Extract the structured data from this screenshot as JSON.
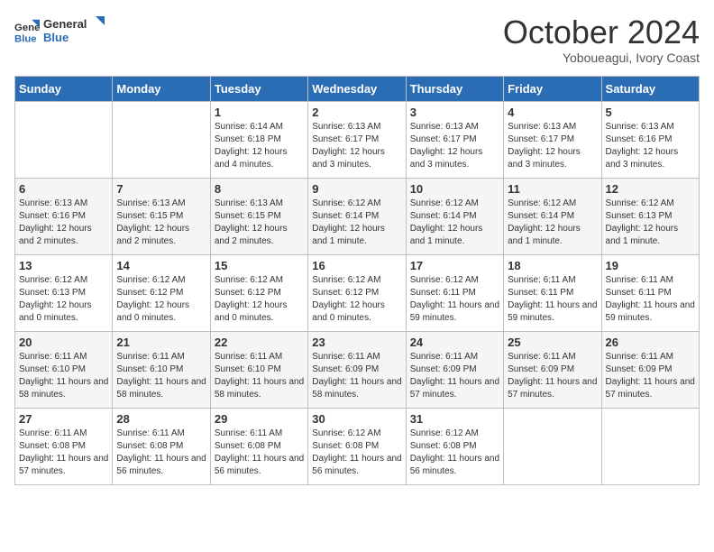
{
  "header": {
    "logo_line1": "General",
    "logo_line2": "Blue",
    "month": "October 2024",
    "location": "Yoboueagui, Ivory Coast"
  },
  "days_of_week": [
    "Sunday",
    "Monday",
    "Tuesday",
    "Wednesday",
    "Thursday",
    "Friday",
    "Saturday"
  ],
  "weeks": [
    [
      {
        "date": "",
        "info": ""
      },
      {
        "date": "",
        "info": ""
      },
      {
        "date": "1",
        "info": "Sunrise: 6:14 AM\nSunset: 6:18 PM\nDaylight: 12 hours and 4 minutes."
      },
      {
        "date": "2",
        "info": "Sunrise: 6:13 AM\nSunset: 6:17 PM\nDaylight: 12 hours and 3 minutes."
      },
      {
        "date": "3",
        "info": "Sunrise: 6:13 AM\nSunset: 6:17 PM\nDaylight: 12 hours and 3 minutes."
      },
      {
        "date": "4",
        "info": "Sunrise: 6:13 AM\nSunset: 6:17 PM\nDaylight: 12 hours and 3 minutes."
      },
      {
        "date": "5",
        "info": "Sunrise: 6:13 AM\nSunset: 6:16 PM\nDaylight: 12 hours and 3 minutes."
      }
    ],
    [
      {
        "date": "6",
        "info": "Sunrise: 6:13 AM\nSunset: 6:16 PM\nDaylight: 12 hours and 2 minutes."
      },
      {
        "date": "7",
        "info": "Sunrise: 6:13 AM\nSunset: 6:15 PM\nDaylight: 12 hours and 2 minutes."
      },
      {
        "date": "8",
        "info": "Sunrise: 6:13 AM\nSunset: 6:15 PM\nDaylight: 12 hours and 2 minutes."
      },
      {
        "date": "9",
        "info": "Sunrise: 6:12 AM\nSunset: 6:14 PM\nDaylight: 12 hours and 1 minute."
      },
      {
        "date": "10",
        "info": "Sunrise: 6:12 AM\nSunset: 6:14 PM\nDaylight: 12 hours and 1 minute."
      },
      {
        "date": "11",
        "info": "Sunrise: 6:12 AM\nSunset: 6:14 PM\nDaylight: 12 hours and 1 minute."
      },
      {
        "date": "12",
        "info": "Sunrise: 6:12 AM\nSunset: 6:13 PM\nDaylight: 12 hours and 1 minute."
      }
    ],
    [
      {
        "date": "13",
        "info": "Sunrise: 6:12 AM\nSunset: 6:13 PM\nDaylight: 12 hours and 0 minutes."
      },
      {
        "date": "14",
        "info": "Sunrise: 6:12 AM\nSunset: 6:12 PM\nDaylight: 12 hours and 0 minutes."
      },
      {
        "date": "15",
        "info": "Sunrise: 6:12 AM\nSunset: 6:12 PM\nDaylight: 12 hours and 0 minutes."
      },
      {
        "date": "16",
        "info": "Sunrise: 6:12 AM\nSunset: 6:12 PM\nDaylight: 12 hours and 0 minutes."
      },
      {
        "date": "17",
        "info": "Sunrise: 6:12 AM\nSunset: 6:11 PM\nDaylight: 11 hours and 59 minutes."
      },
      {
        "date": "18",
        "info": "Sunrise: 6:11 AM\nSunset: 6:11 PM\nDaylight: 11 hours and 59 minutes."
      },
      {
        "date": "19",
        "info": "Sunrise: 6:11 AM\nSunset: 6:11 PM\nDaylight: 11 hours and 59 minutes."
      }
    ],
    [
      {
        "date": "20",
        "info": "Sunrise: 6:11 AM\nSunset: 6:10 PM\nDaylight: 11 hours and 58 minutes."
      },
      {
        "date": "21",
        "info": "Sunrise: 6:11 AM\nSunset: 6:10 PM\nDaylight: 11 hours and 58 minutes."
      },
      {
        "date": "22",
        "info": "Sunrise: 6:11 AM\nSunset: 6:10 PM\nDaylight: 11 hours and 58 minutes."
      },
      {
        "date": "23",
        "info": "Sunrise: 6:11 AM\nSunset: 6:09 PM\nDaylight: 11 hours and 58 minutes."
      },
      {
        "date": "24",
        "info": "Sunrise: 6:11 AM\nSunset: 6:09 PM\nDaylight: 11 hours and 57 minutes."
      },
      {
        "date": "25",
        "info": "Sunrise: 6:11 AM\nSunset: 6:09 PM\nDaylight: 11 hours and 57 minutes."
      },
      {
        "date": "26",
        "info": "Sunrise: 6:11 AM\nSunset: 6:09 PM\nDaylight: 11 hours and 57 minutes."
      }
    ],
    [
      {
        "date": "27",
        "info": "Sunrise: 6:11 AM\nSunset: 6:08 PM\nDaylight: 11 hours and 57 minutes."
      },
      {
        "date": "28",
        "info": "Sunrise: 6:11 AM\nSunset: 6:08 PM\nDaylight: 11 hours and 56 minutes."
      },
      {
        "date": "29",
        "info": "Sunrise: 6:11 AM\nSunset: 6:08 PM\nDaylight: 11 hours and 56 minutes."
      },
      {
        "date": "30",
        "info": "Sunrise: 6:12 AM\nSunset: 6:08 PM\nDaylight: 11 hours and 56 minutes."
      },
      {
        "date": "31",
        "info": "Sunrise: 6:12 AM\nSunset: 6:08 PM\nDaylight: 11 hours and 56 minutes."
      },
      {
        "date": "",
        "info": ""
      },
      {
        "date": "",
        "info": ""
      }
    ]
  ]
}
